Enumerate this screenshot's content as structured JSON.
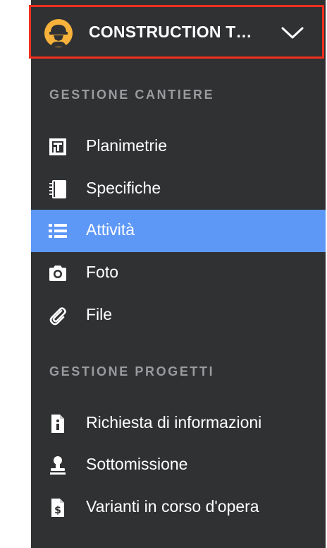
{
  "project": {
    "name": "CONSTRUCTION T…",
    "logo_icon": "construction-worker-icon",
    "dropdown_icon": "chevron-down-icon"
  },
  "colors": {
    "sidebar_bg": "#303133",
    "active_bg": "#5e98f7",
    "highlight_border": "#f0301e",
    "section_text": "#9a9b9e",
    "logo_yellow": "#f6b23a"
  },
  "sections": [
    {
      "title": "GESTIONE CANTIERE",
      "items": [
        {
          "label": "Planimetrie",
          "icon": "floorplan-icon",
          "active": false
        },
        {
          "label": "Specifiche",
          "icon": "notebook-icon",
          "active": false
        },
        {
          "label": "Attività",
          "icon": "list-icon",
          "active": true
        },
        {
          "label": "Foto",
          "icon": "camera-icon",
          "active": false
        },
        {
          "label": "File",
          "icon": "paperclip-icon",
          "active": false
        }
      ]
    },
    {
      "title": "GESTIONE PROGETTI",
      "items": [
        {
          "label": "Richiesta di informazioni",
          "icon": "info-document-icon",
          "active": false
        },
        {
          "label": "Sottomissione",
          "icon": "stamp-icon",
          "active": false
        },
        {
          "label": "Varianti in corso d'opera",
          "icon": "dollar-document-icon",
          "active": false
        }
      ]
    }
  ]
}
